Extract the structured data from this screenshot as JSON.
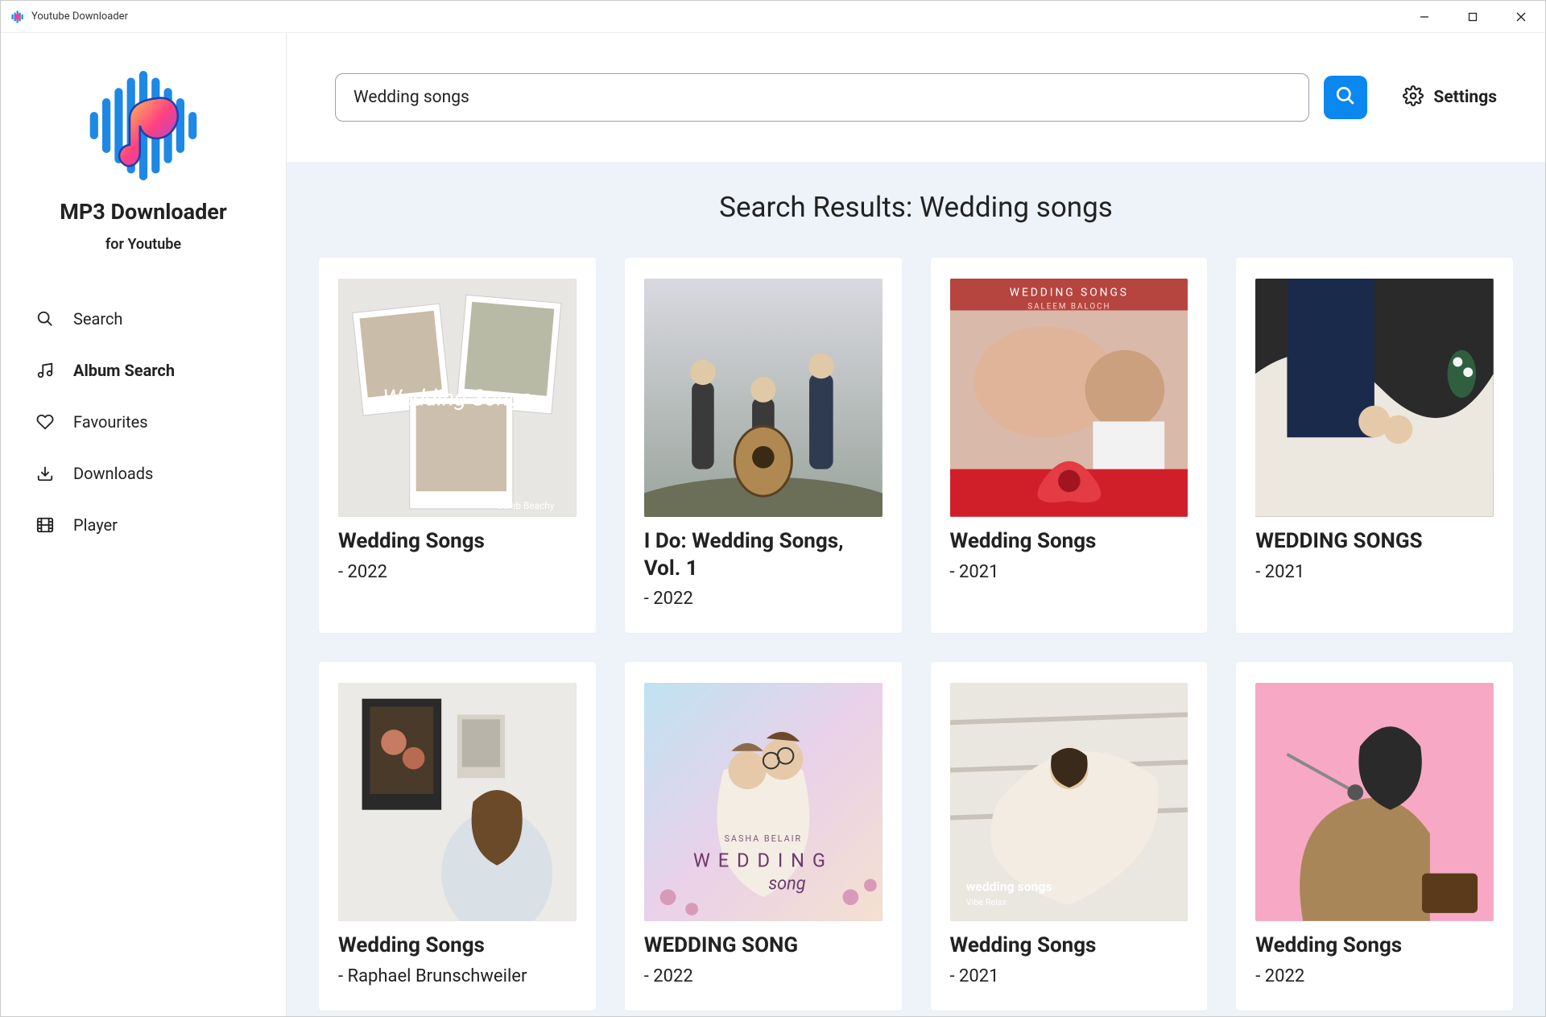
{
  "window": {
    "title": "Youtube Downloader"
  },
  "app": {
    "name": "MP3 Downloader",
    "subtitle": "for Youtube"
  },
  "nav": {
    "items": [
      {
        "label": "Search",
        "icon": "search-icon",
        "active": false
      },
      {
        "label": "Album Search",
        "icon": "music-note-icon",
        "active": true
      },
      {
        "label": "Favourites",
        "icon": "heart-icon",
        "active": false
      },
      {
        "label": "Downloads",
        "icon": "download-icon",
        "active": false
      },
      {
        "label": "Player",
        "icon": "film-icon",
        "active": false
      }
    ]
  },
  "search": {
    "value": "Wedding songs",
    "placeholder": "Search"
  },
  "settings": {
    "label": "Settings"
  },
  "results": {
    "title": "Search Results: Wedding songs",
    "items": [
      {
        "title": "Wedding Songs",
        "meta": "- 2022"
      },
      {
        "title": "I Do: Wedding Songs, Vol. 1",
        "meta": "- 2022"
      },
      {
        "title": "Wedding Songs",
        "meta": "- 2021"
      },
      {
        "title": "WEDDING SONGS",
        "meta": "- 2021"
      },
      {
        "title": "Wedding Songs",
        "meta": "- Raphael Brunschweiler"
      },
      {
        "title": "WEDDING SONG",
        "meta": "- 2022"
      },
      {
        "title": "Wedding Songs",
        "meta": "- 2021"
      },
      {
        "title": "Wedding Songs",
        "meta": "- 2022"
      }
    ]
  },
  "colors": {
    "accent": "#0b87f0",
    "panel": "#eef2f9"
  }
}
